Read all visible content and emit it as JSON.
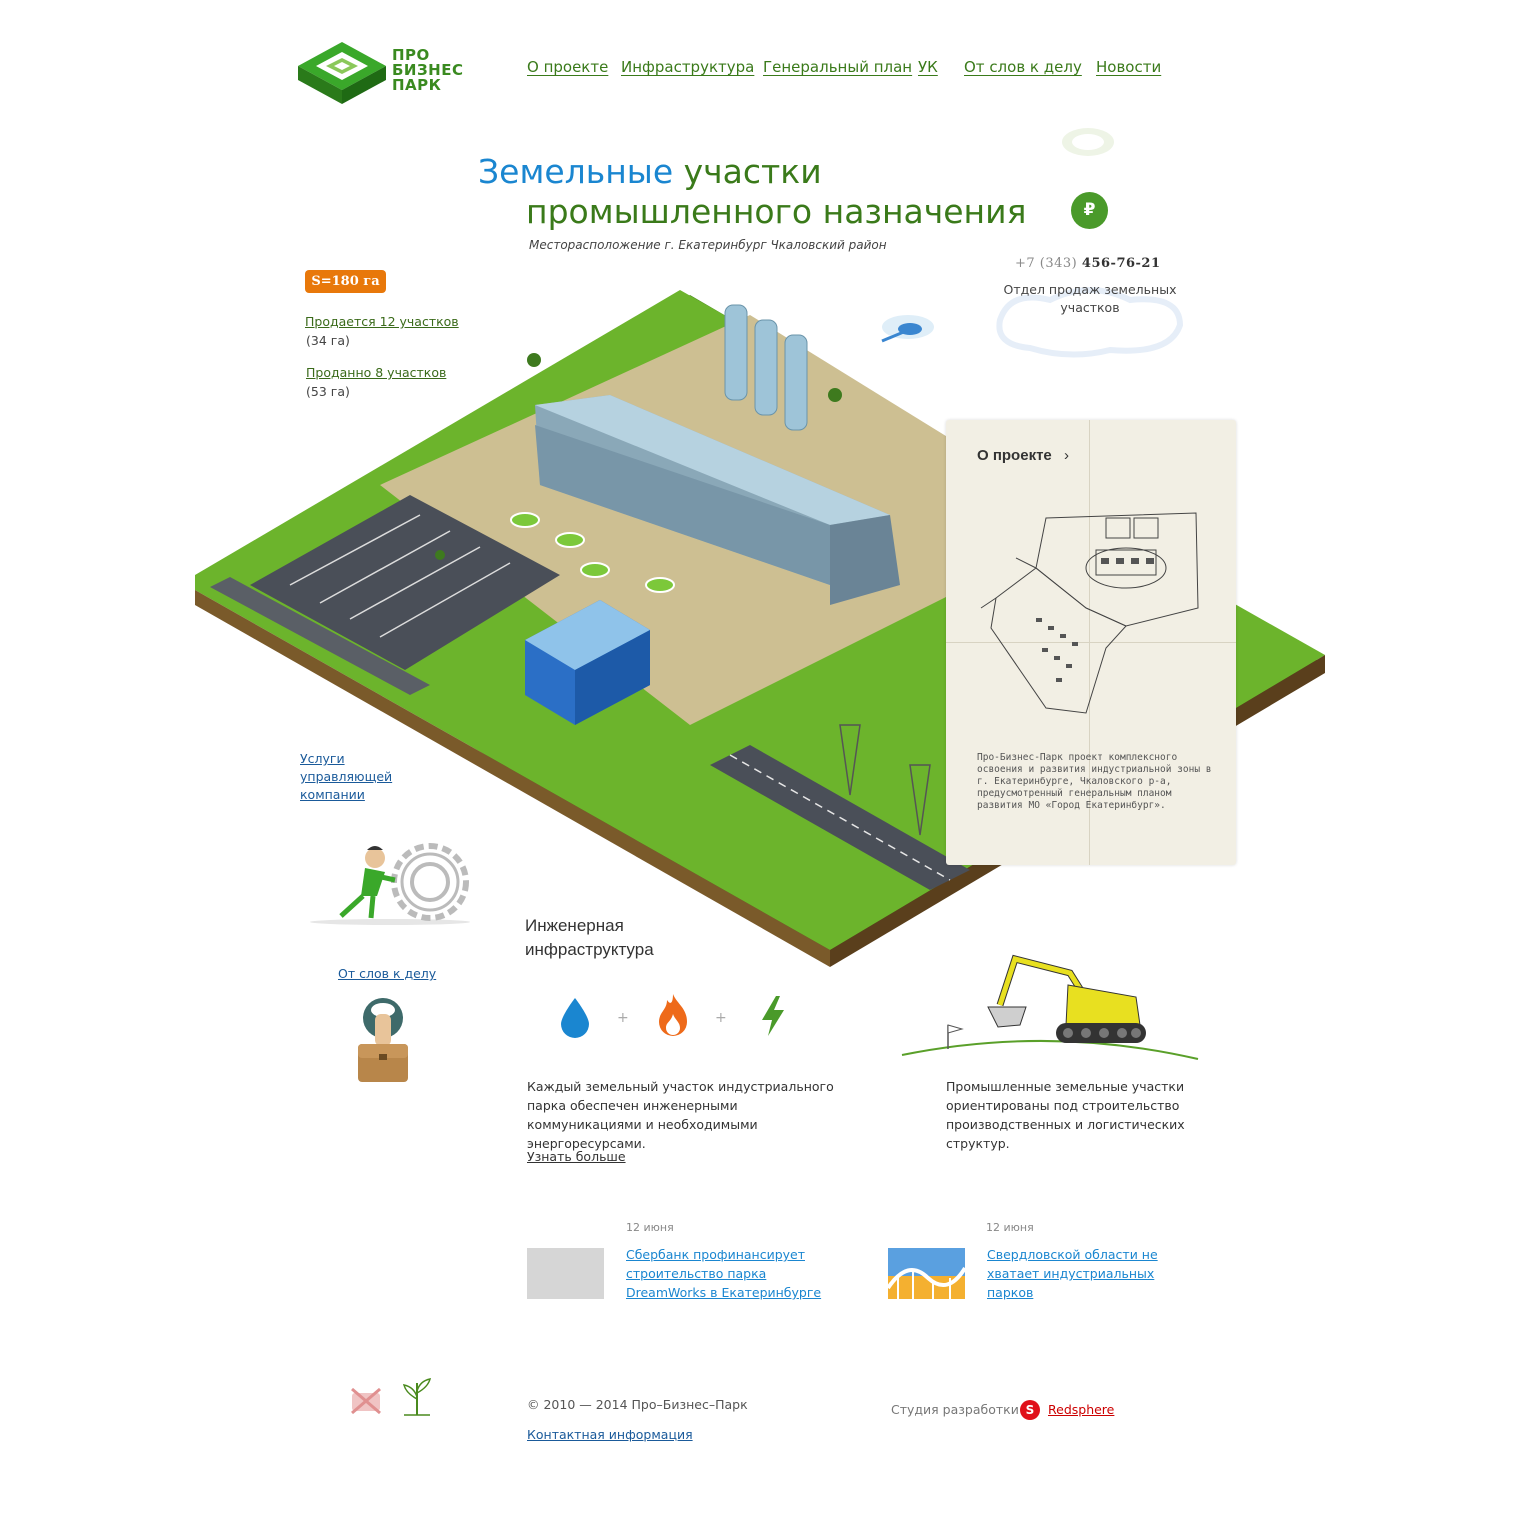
{
  "brand": {
    "logo_line1": "ПРО",
    "logo_line2": "БИЗНЕС",
    "logo_line3": "ПАРК"
  },
  "nav": {
    "items": [
      "О проекте",
      "Инфраструктура",
      "Генеральный план",
      "УК",
      "От слов к делу",
      "Новости"
    ]
  },
  "hero": {
    "title_word1": "Земельные",
    "title_word2": "участки",
    "title_line2": "промышленного назначения",
    "location": "Месторасположение г. Екатеринбург Чкаловский район",
    "ruble_symbol": "₽"
  },
  "contact": {
    "phone_prefix": "+7 (343)",
    "phone_number": "456-76-21",
    "department": "Отдел продаж земельных участков"
  },
  "stats": {
    "area_badge": "S=180 га",
    "for_sale_link": "Продается 12 участков",
    "for_sale_area": "(34 га)",
    "sold_link": "Проданно 8 участков",
    "sold_area": "(53 га)"
  },
  "sidebar": {
    "services_line1": "Услуги",
    "services_line2": "управляющей",
    "services_line3": "компании",
    "words_to_deeds": "От слов к делу"
  },
  "project_panel": {
    "title": "О проекте",
    "arrow": "›",
    "description": "Про-Бизнес-Парк проект комплексного освоения и развития индустриальной зоны в г. Екатеринбурге, Чкаловского р-а, предусмотренный генеральным планом развития МО «Город Екатеринбург»."
  },
  "infrastructure": {
    "title_line1": "Инженерная",
    "title_line2": "инфраструктура",
    "description": "Каждый земельный участок индустриального парка обеспечен инженерными коммуникациями и необходимыми энергоресурсами.",
    "more_link": "Узнать больше",
    "icons": [
      "water-drop-icon",
      "fire-icon",
      "lightning-icon"
    ],
    "colors": {
      "water": "#1a86d0",
      "fire": "#ee6a1a",
      "power": "#4a9a2a"
    }
  },
  "industrial": {
    "description": "Промышленные земельные участки ориентированы под строительство производственных и логистических структур."
  },
  "news": [
    {
      "date": "12 июня",
      "title": "Сбербанк профинансирует строительство парка DreamWorks в Екатеринбурге"
    },
    {
      "date": "12 июня",
      "title": "Свердловской области не хватает индустриальных парков"
    }
  ],
  "footer": {
    "copyright": "© 2010 — 2014 Про–Бизнес–Парк",
    "contact_link": "Контактная информация",
    "studio_label": "Студия разработки",
    "studio_name": "Redsphere",
    "studio_logo_letter": "S"
  },
  "colors": {
    "brand_green": "#3a8a20",
    "title_blue": "#1a86d0",
    "badge_orange": "#e8780a",
    "panel_bg": "#f2efe4"
  }
}
